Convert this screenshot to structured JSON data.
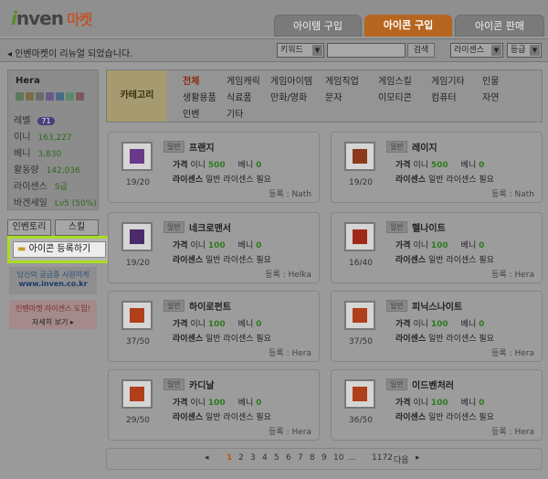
{
  "header": {
    "logo_text": "nven",
    "logo_i": "i",
    "logo_market": "마켓",
    "tabs": [
      "아이템 구입",
      "아이콘 구입",
      "아이콘 판매"
    ]
  },
  "notice": {
    "text": "◂ 인벤마켓이 리뉴얼 되었습니다.",
    "search_type": "키워드",
    "search_value": "",
    "search_btn": "검색",
    "filter1": "라이센스",
    "filter2": "등급"
  },
  "profile": {
    "name": "Hera",
    "level_label": "레벨",
    "level_value": "71",
    "stats": [
      {
        "label": "이니",
        "value": "163,227"
      },
      {
        "label": "베니",
        "value": "3,830"
      },
      {
        "label": "활동량",
        "value": "142,036"
      },
      {
        "label": "라이센스",
        "value": "S급"
      },
      {
        "label": "바겐세일",
        "value": "Lv5 (50%)"
      }
    ]
  },
  "sidebar": {
    "inventory": "인벤토리",
    "skill": "스킬",
    "register": "아이콘 등록하기",
    "ad1_line1": "당신의 궁금증 시원하게",
    "ad1_line2": "www.inven.co.kr",
    "ad2_line1": "인벤마켓 라이센스 도입!",
    "ad2_line2": "자세히 보기 ▸"
  },
  "categories": {
    "label": "카테고리",
    "rows": [
      [
        "전체",
        "게임캐릭",
        "게임아이템",
        "게임직업",
        "게임스킬",
        "게임기타",
        "인물"
      ],
      [
        "생활용품",
        "식료품",
        "만화/영화",
        "문자",
        "이모티콘",
        "컴퓨터",
        "자연"
      ],
      [
        "인벤",
        "기타"
      ]
    ]
  },
  "cards": [
    {
      "name": "프랜지",
      "count": "19/20",
      "price_label": "가격",
      "ini_label": "이니",
      "ini": "500",
      "beni_label": "베니",
      "beni": "0",
      "lic_label": "라이센스",
      "lic": "일반 라이센스 필요",
      "by": "등록 : Nath",
      "tag": "일반",
      "color": "#6a3a8a"
    },
    {
      "name": "레이지",
      "count": "19/20",
      "price_label": "가격",
      "ini_label": "이니",
      "ini": "500",
      "beni_label": "베니",
      "beni": "0",
      "lic_label": "라이센스",
      "lic": "일반 라이센스 필요",
      "by": "등록 : Nath",
      "tag": "일반",
      "color": "#8a3a1a"
    },
    {
      "name": "네크로맨서",
      "count": "19/20",
      "price_label": "가격",
      "ini_label": "이니",
      "ini": "100",
      "beni_label": "베니",
      "beni": "0",
      "lic_label": "라이센스",
      "lic": "일반 라이센스 필요",
      "by": "등록 : Helka",
      "tag": "일반",
      "color": "#4a2a6a"
    },
    {
      "name": "헬나이트",
      "count": "16/40",
      "price_label": "가격",
      "ini_label": "이니",
      "ini": "100",
      "beni_label": "베니",
      "beni": "0",
      "lic_label": "라이센스",
      "lic": "일반 라이센스 필요",
      "by": "등록 : Hera",
      "tag": "일반",
      "color": "#a02a1a"
    },
    {
      "name": "하이로펀트",
      "count": "37/50",
      "price_label": "가격",
      "ini_label": "이니",
      "ini": "100",
      "beni_label": "베니",
      "beni": "0",
      "lic_label": "라이센스",
      "lic": "일반 라이센스 필요",
      "by": "등록 : Hera",
      "tag": "일반",
      "color": "#b0401a"
    },
    {
      "name": "피닉스나이트",
      "count": "37/50",
      "price_label": "가격",
      "ini_label": "이니",
      "ini": "100",
      "beni_label": "베니",
      "beni": "0",
      "lic_label": "라이센스",
      "lic": "일반 라이센스 필요",
      "by": "등록 : Hera",
      "tag": "일반",
      "color": "#b0401a"
    },
    {
      "name": "카디날",
      "count": "29/50",
      "price_label": "가격",
      "ini_label": "이니",
      "ini": "100",
      "beni_label": "베니",
      "beni": "0",
      "lic_label": "라이센스",
      "lic": "일반 라이센스 필요",
      "by": "등록 : Hera",
      "tag": "일반",
      "color": "#b0401a"
    },
    {
      "name": "이드벤처러",
      "count": "36/50",
      "price_label": "가격",
      "ini_label": "이니",
      "ini": "100",
      "beni_label": "베니",
      "beni": "0",
      "lic_label": "라이센스",
      "lic": "일반 라이센스 필요",
      "by": "등록 : Hera",
      "tag": "일반",
      "color": "#b0401a"
    }
  ],
  "pager": {
    "pages": [
      "1",
      "2",
      "3",
      "4",
      "5",
      "6",
      "7",
      "8",
      "9",
      "10"
    ],
    "current": "1",
    "gap": "...",
    "last": "1172",
    "next": "다음"
  },
  "colors": {
    "accent_tab": "#b7651e",
    "highlight": "#aadd22",
    "arrow": "#e8f000"
  }
}
